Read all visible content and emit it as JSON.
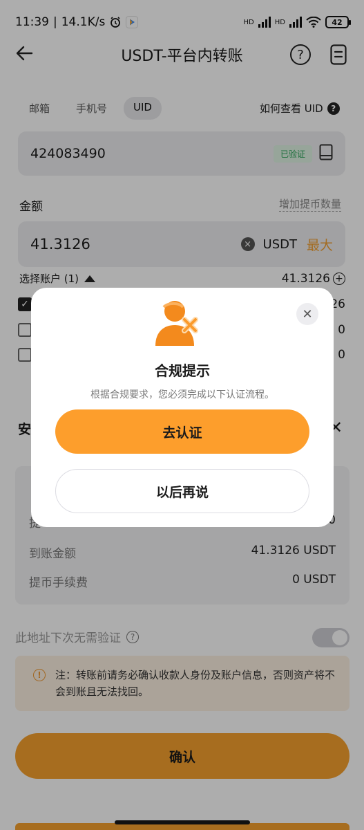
{
  "status_bar": {
    "time": "11:39",
    "speed": "14.1K/s",
    "sig_tag_1": "HD",
    "sig_tag_2": "HD",
    "battery": "42"
  },
  "header": {
    "title": "USDT-平台内转账"
  },
  "tabs": [
    {
      "label": "邮箱"
    },
    {
      "label": "手机号"
    },
    {
      "label": "UID"
    }
  ],
  "uid_help": "如何查看 UID",
  "uid_field": {
    "value": "424083490",
    "verified": "已验证"
  },
  "amount": {
    "label": "金额",
    "add_link": "增加提币数量",
    "value": "41.3126",
    "currency": "USDT",
    "max": "最大"
  },
  "accounts": {
    "label": "选择账户 (1)",
    "balance": "41.3126",
    "items": [
      {
        "value": "26",
        "checked": true
      },
      {
        "value": "0",
        "checked": false
      },
      {
        "value": "0",
        "checked": false
      }
    ]
  },
  "sheet": {
    "title": "安",
    "rows": [
      {
        "label": "",
        "value": ""
      },
      {
        "label": "提",
        "value": "0"
      },
      {
        "label": "到账金额",
        "value": "41.3126 USDT"
      },
      {
        "label": "提币手续费",
        "value": "0 USDT"
      }
    ],
    "no_verify": "此地址下次无需验证",
    "notice": "注：转账前请务必确认收款人身份及账户信息，否则资产将不会到账且无法找回。",
    "confirm": "确认"
  },
  "dialog": {
    "title": "合规提示",
    "subtitle": "根据合规要求，您必须完成以下认证流程。",
    "primary": "去认证",
    "secondary": "以后再说"
  },
  "colors": {
    "accent": "#fd9e2c",
    "verified": "#2ea55a"
  }
}
